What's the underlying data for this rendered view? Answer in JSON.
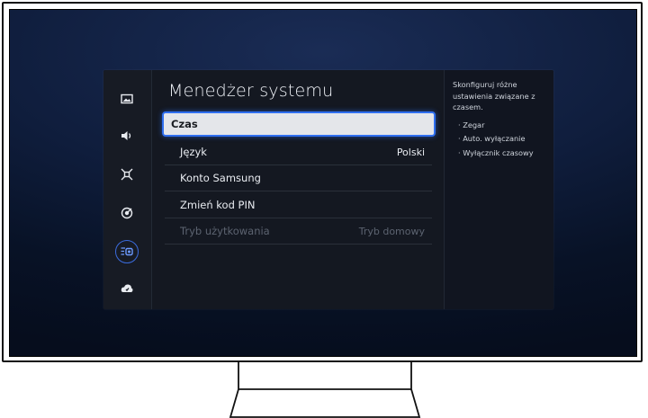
{
  "menu": {
    "title": "Menedżer systemu",
    "items": [
      {
        "label": "Czas",
        "value": ""
      },
      {
        "label": "Język",
        "value": "Polski"
      },
      {
        "label": "Konto Samsung",
        "value": ""
      },
      {
        "label": "Zmień kod PIN",
        "value": ""
      },
      {
        "label": "Tryb użytkowania",
        "value": "Tryb domowy"
      }
    ]
  },
  "sidebar": {
    "icons": [
      "picture-icon",
      "sound-icon",
      "connection-icon",
      "broadcast-icon",
      "system-manager-icon",
      "support-icon"
    ]
  },
  "info": {
    "description": "Skonfiguruj różne ustawienia związane z czasem.",
    "bullets": [
      "· Zegar",
      "· Auto. wyłączanie",
      "· Wyłącznik czasowy"
    ]
  },
  "colors": {
    "accent": "#2f6ff0",
    "panel": "#141821",
    "screen": "#0f1d3c"
  }
}
